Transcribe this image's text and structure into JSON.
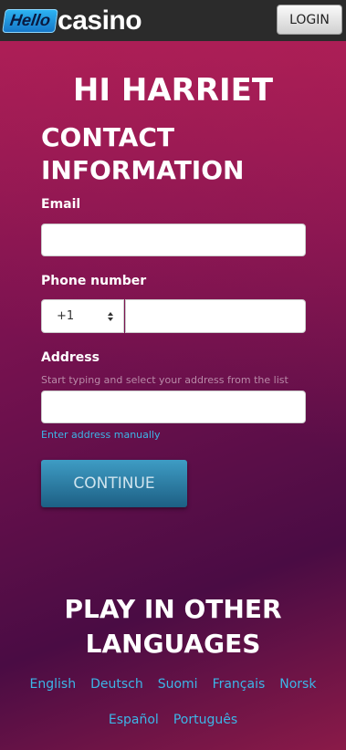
{
  "header": {
    "logo_hello": "Hello",
    "logo_casino": "casino",
    "login_label": "LOGIN"
  },
  "greeting": "HI HARRIET",
  "form": {
    "title": "CONTACT INFORMATION",
    "email": {
      "label": "Email",
      "value": ""
    },
    "phone": {
      "label": "Phone number",
      "country_code": "+1",
      "value": ""
    },
    "address": {
      "label": "Address",
      "hint": "Start typing and select your address from the list",
      "value": "",
      "manual_link": "Enter address manually"
    },
    "continue_label": "CONTINUE"
  },
  "languages": {
    "title": "PLAY IN OTHER LANGUAGES",
    "row1": [
      "English",
      "Deutsch",
      "Suomi",
      "Français",
      "Norsk"
    ],
    "row2": [
      "Español",
      "Português"
    ]
  },
  "colors": {
    "accent_link": "#3cb6e8",
    "topbar": "#2b2b2b",
    "button": "#2a7aa3"
  }
}
